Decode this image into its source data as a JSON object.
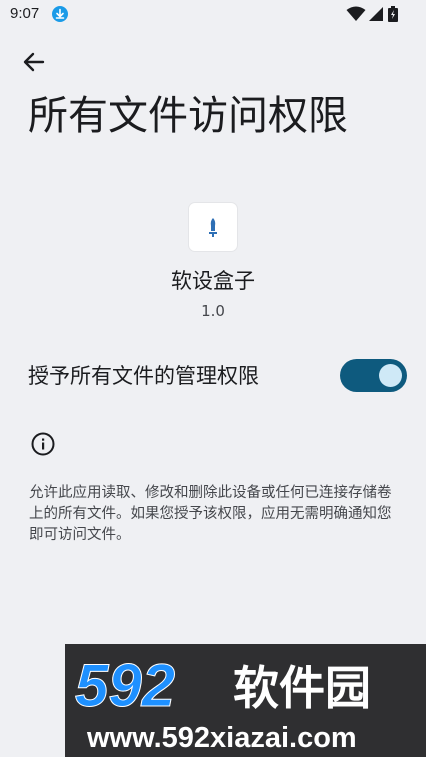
{
  "status_bar": {
    "time": "9:07",
    "notification_icon": "download-icon",
    "icons": [
      "wifi-icon",
      "cellular-icon",
      "battery-icon"
    ]
  },
  "header": {
    "back_icon": "arrow-left-icon",
    "title": "所有文件访问权限"
  },
  "app": {
    "icon": "app-logo-icon",
    "name": "软设盒子",
    "version": "1.0"
  },
  "permission": {
    "label": "授予所有文件的管理权限",
    "enabled": true
  },
  "info": {
    "icon": "info-icon",
    "description": "允许此应用读取、修改和删除此设备或任何已连接存储卷上的所有文件。如果您授予该权限，应用无需明确通知您即可访问文件。"
  },
  "watermark": {
    "brand_number": "592",
    "brand_name": "软件园",
    "url": "www.592xiazai.com"
  },
  "colors": {
    "background": "#eff0f3",
    "toggle_track": "#0e5a7e",
    "toggle_thumb": "#cfe9f7",
    "watermark_accent": "#1e90ff"
  }
}
